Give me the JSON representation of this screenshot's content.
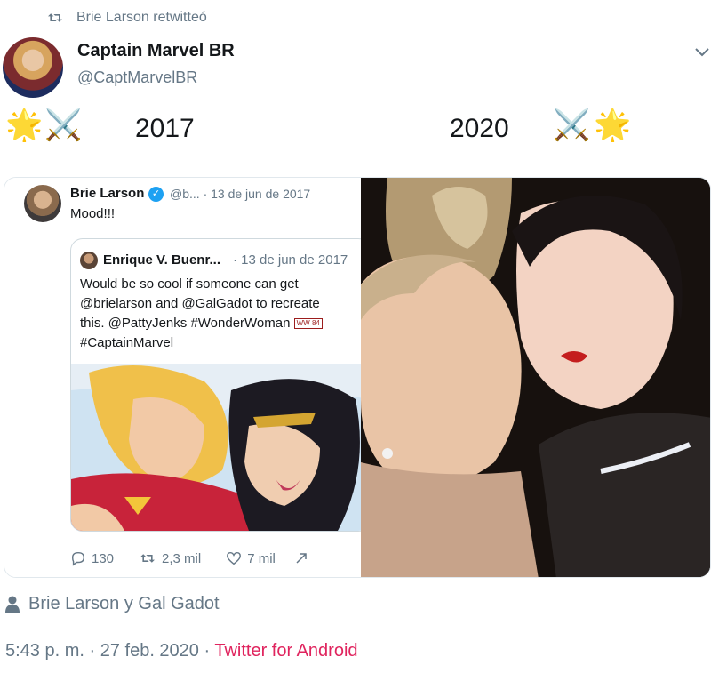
{
  "retweet": {
    "text": "Brie Larson retwitteó",
    "icon": "retweet-icon"
  },
  "author": {
    "name": "Captain Marvel BR",
    "handle": "@CaptMarvelBR",
    "avatar": "avatar"
  },
  "tweet": {
    "year_left": "2017",
    "year_right": "2020",
    "emoji_star": "🌟",
    "emoji_swords": "⚔️"
  },
  "embedded": {
    "name": "Brie Larson",
    "handle": "@b...",
    "date": "· 13 de jun de 2017",
    "text": "Mood!!!",
    "quote": {
      "name": "Enrique V. Buenr...",
      "date": "· 13 de jun de 2017",
      "lines": [
        "Would be so cool if someone can get",
        "@brielarson and @GalGadot to recreate",
        "this. @PattyJenks #WonderWoman",
        "#CaptainMarvel"
      ],
      "ww_badge": "WW 84"
    },
    "stats": {
      "replies": "130",
      "retweets": "2,3 mil",
      "likes": "7 mil"
    }
  },
  "footer": {
    "tagged": "Brie Larson y Gal Gadot",
    "time": "5:43 p. m. · 27 feb. 2020 · ",
    "source": "Twitter for Android"
  },
  "colors": {
    "link": "#e0245e",
    "muted": "#657786",
    "verified": "#1da1f2"
  }
}
